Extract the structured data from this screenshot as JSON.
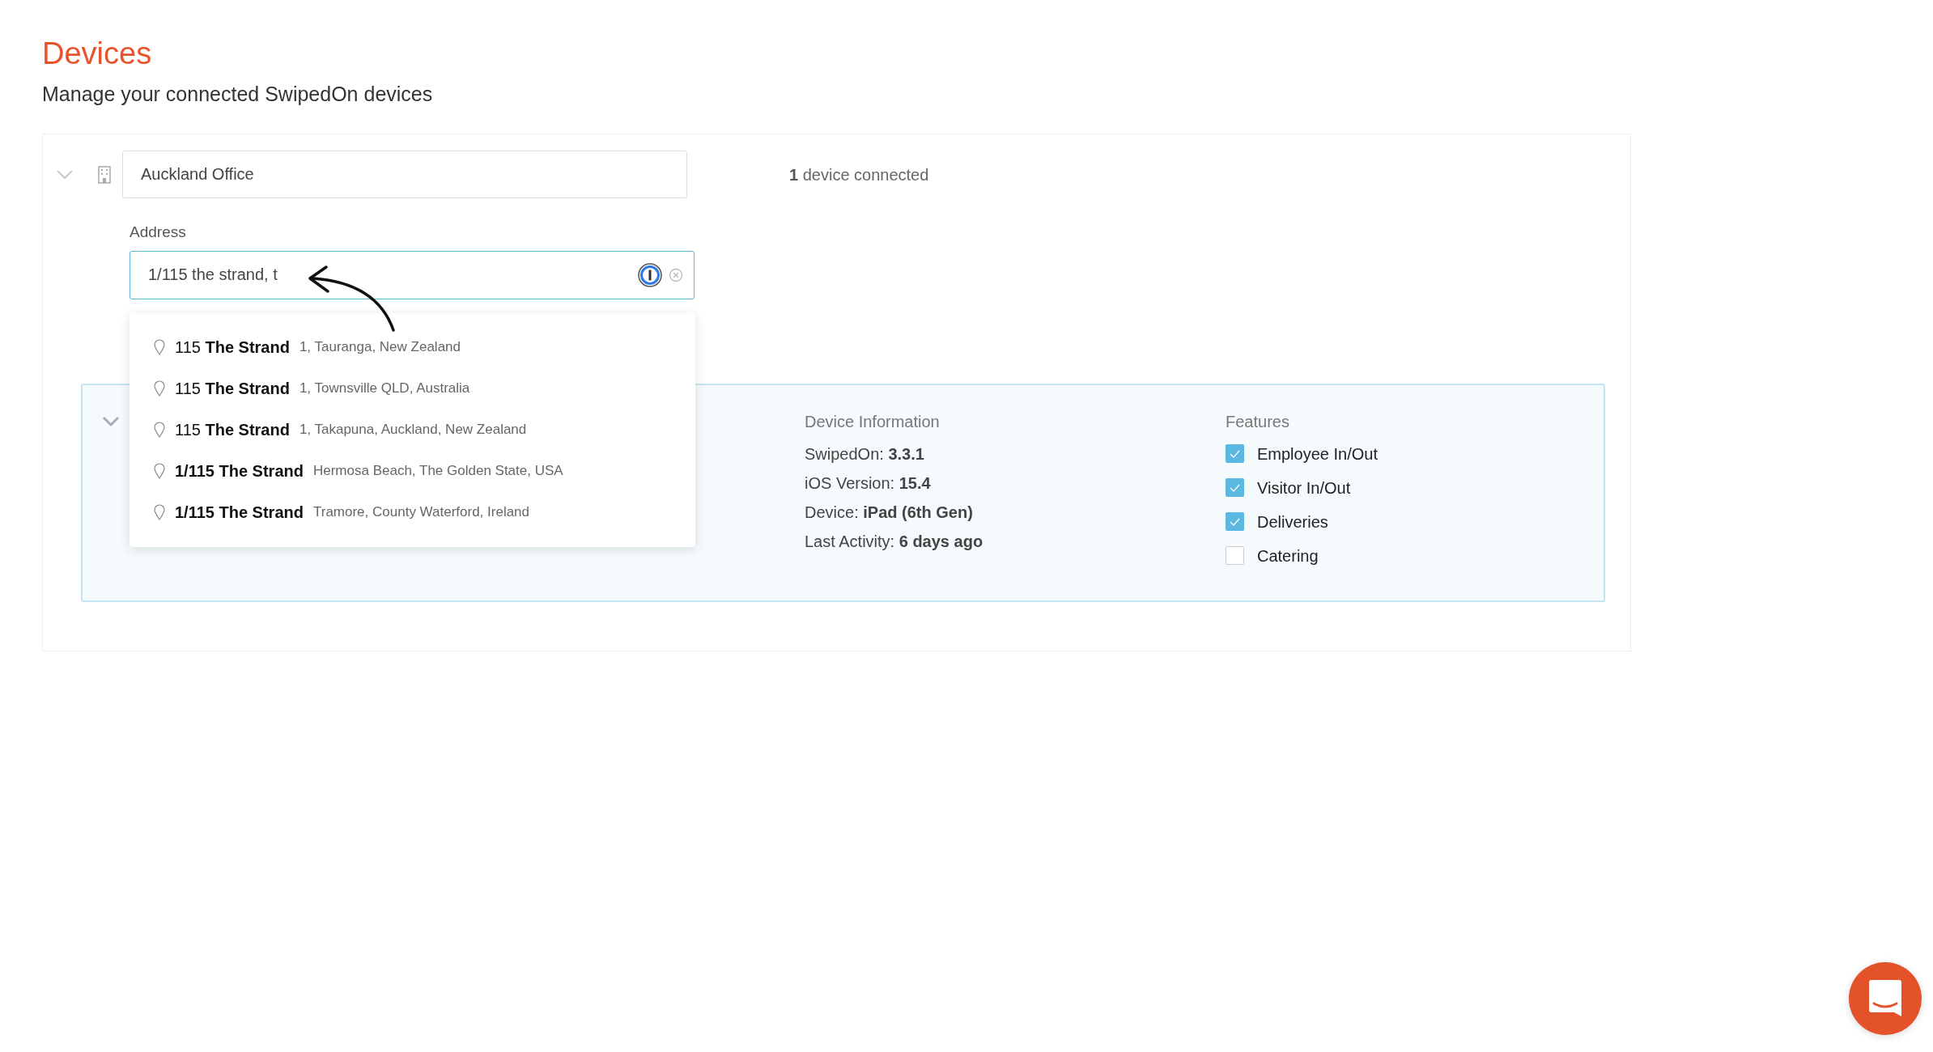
{
  "page": {
    "title": "Devices",
    "subtitle": "Manage your connected SwipedOn devices"
  },
  "location": {
    "expanded": true,
    "name": "Auckland Office",
    "device_count": "1",
    "device_count_label": "device connected",
    "address_label": "Address",
    "address_value": "1/115 the strand, t"
  },
  "suggestions": [
    {
      "main": "115 **The Strand**",
      "detail": "1, Tauranga, New Zealand"
    },
    {
      "main": "115 **The Strand**",
      "detail": "1, Townsville QLD, Australia"
    },
    {
      "main": "115 **The Strand**",
      "detail": "1, Takapuna, Auckland, New Zealand"
    },
    {
      "main": "**1/115 The Strand**",
      "detail": "Hermosa Beach, The Golden State, USA"
    },
    {
      "main": "**1/115 The Strand**",
      "detail": "Tramore, County Waterford, Ireland"
    }
  ],
  "device": {
    "expanded": true,
    "info_heading": "Device Information",
    "info": [
      {
        "label": "SwipedOn:",
        "value": "3.3.1"
      },
      {
        "label": "iOS Version:",
        "value": "15.4"
      },
      {
        "label": "Device:",
        "value": "iPad (6th Gen)"
      },
      {
        "label": "Last Activity:",
        "value": "6 days ago"
      }
    ],
    "features_heading": "Features",
    "features": [
      {
        "label": "Employee In/Out",
        "checked": true
      },
      {
        "label": "Visitor In/Out",
        "checked": true
      },
      {
        "label": "Deliveries",
        "checked": true
      },
      {
        "label": "Catering",
        "checked": false
      }
    ]
  }
}
